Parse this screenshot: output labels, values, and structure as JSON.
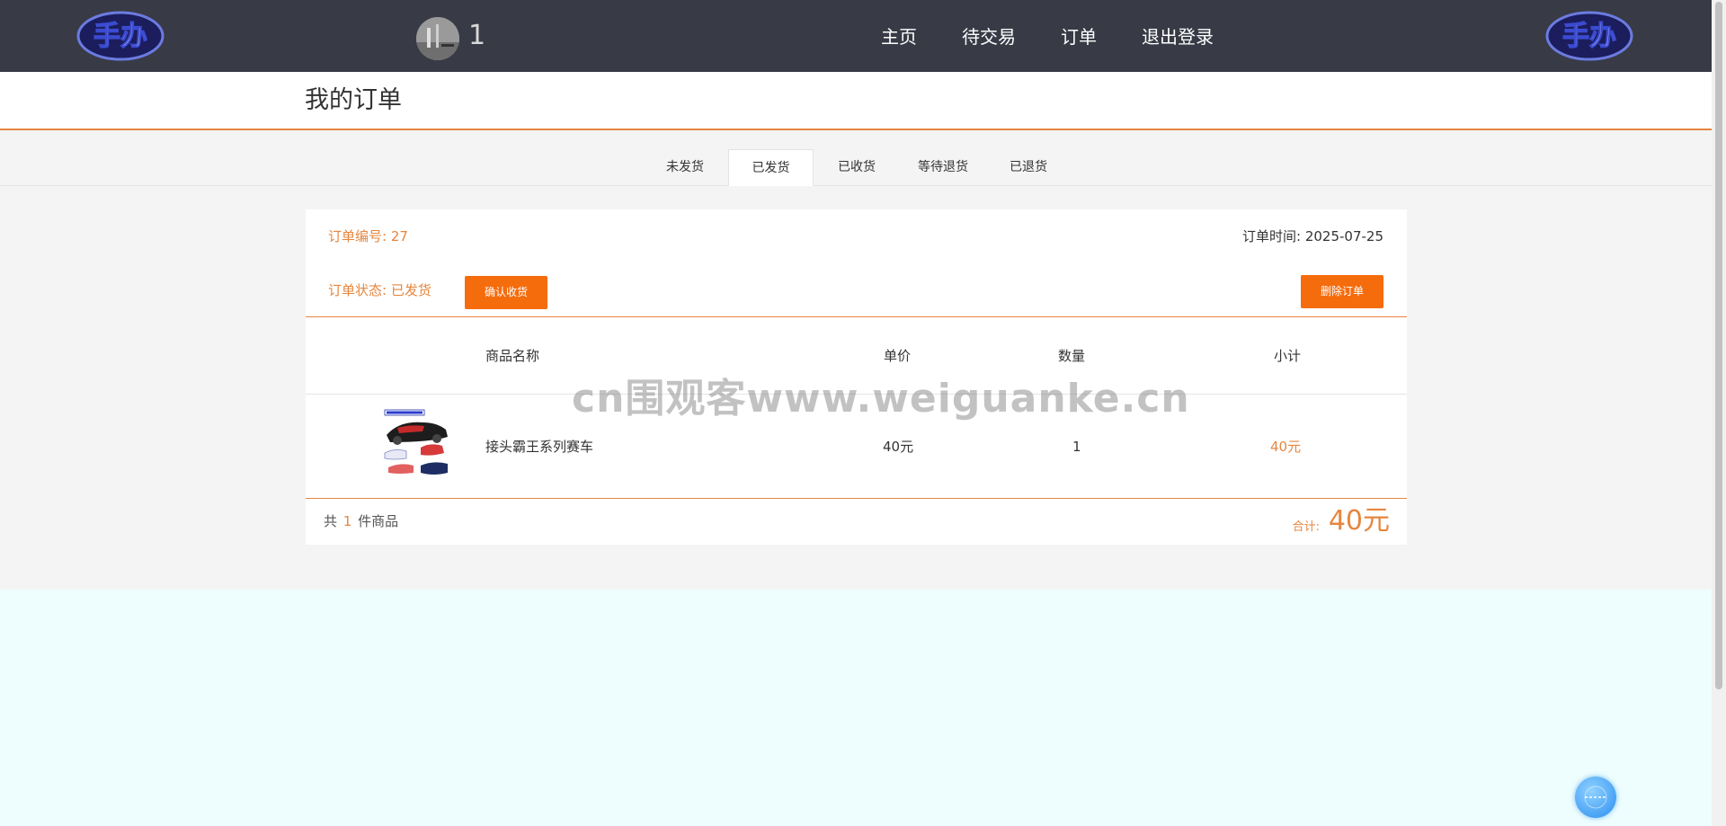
{
  "header": {
    "logo_text": "手办",
    "username": "1",
    "nav": [
      "主页",
      "待交易",
      "订单",
      "退出登录"
    ]
  },
  "page_title": "我的订单",
  "tabs": [
    {
      "label": "未发货",
      "active": false
    },
    {
      "label": "已发货",
      "active": true
    },
    {
      "label": "已收货",
      "active": false
    },
    {
      "label": "等待退货",
      "active": false
    },
    {
      "label": "已退货",
      "active": false
    }
  ],
  "order": {
    "number": "订单编号: 27",
    "time": "订单时间: 2025-07-25",
    "status": "订单状态: 已发货",
    "confirm_button": "确认收货",
    "delete_button": "删除订单",
    "columns": [
      "商品名称",
      "单价",
      "数量",
      "小计"
    ],
    "items": [
      {
        "name": "接头霸王系列赛车",
        "price": "40元",
        "quantity": "1",
        "subtotal": "40元",
        "image_icon": "race-car-toy-icon"
      }
    ],
    "count_prefix": "共",
    "count": "1",
    "count_suffix": "件商品",
    "total_label": "合计:",
    "total_value": "40元"
  },
  "watermark": "cn围观客www.weiguanke.cn",
  "colors": {
    "header_bg": "#383a46",
    "accent": "#e6863f",
    "button": "#f56c0d",
    "content_bg": "#f4f4f4",
    "page_bg": "#eefefe"
  }
}
